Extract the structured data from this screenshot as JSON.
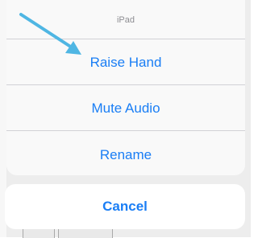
{
  "action_sheet": {
    "title": "iPad",
    "actions": [
      {
        "label": "Raise Hand"
      },
      {
        "label": "Mute Audio"
      },
      {
        "label": "Rename"
      }
    ],
    "cancel_label": "Cancel"
  },
  "annotation": {
    "icon": "pointer-arrow-icon",
    "color": "#4fb6e3"
  },
  "colors": {
    "action_text": "#1a7ef5",
    "title_text": "#8e8e93",
    "sheet_background": "#f9f9f9",
    "cancel_background": "#ffffff",
    "backdrop": "#ededed"
  }
}
